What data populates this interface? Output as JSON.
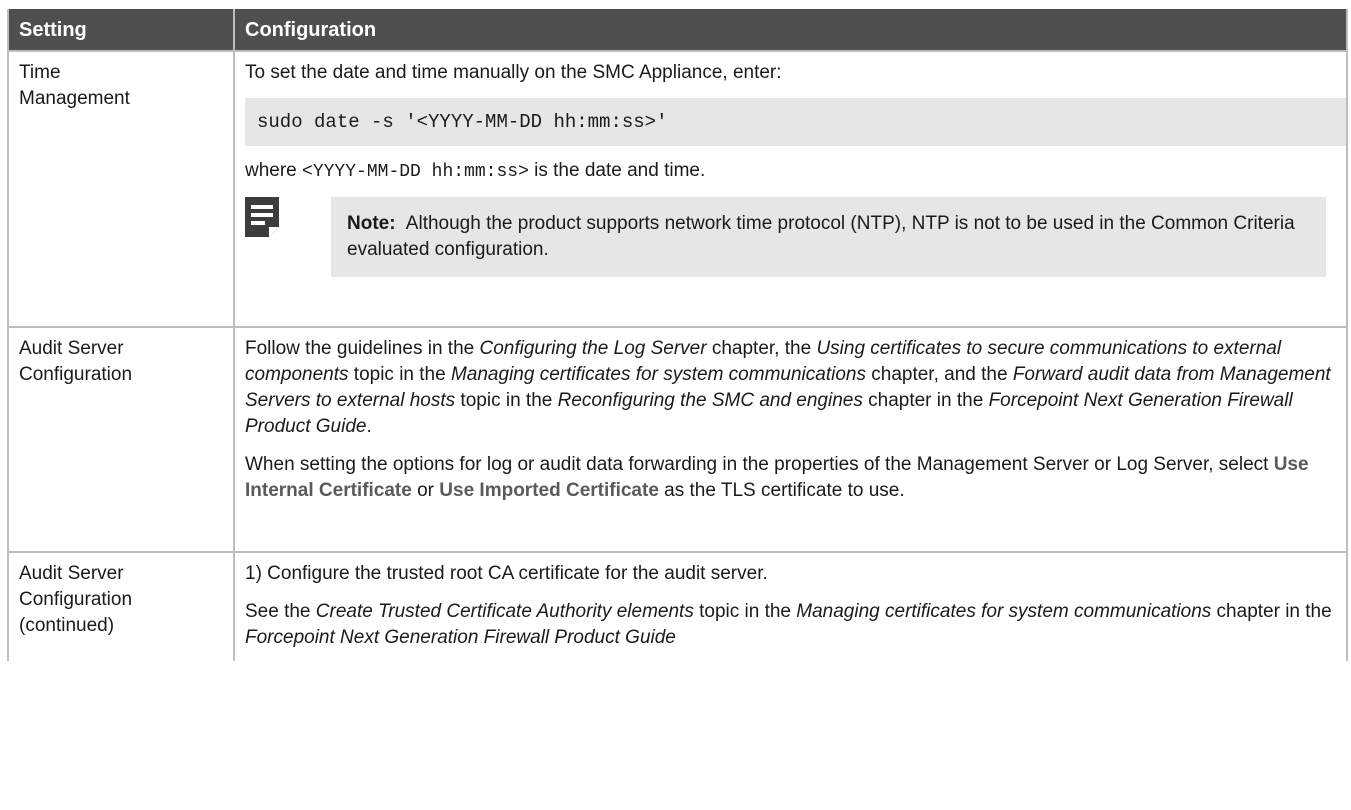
{
  "header": {
    "col_setting": "Setting",
    "col_configuration": "Configuration"
  },
  "row1": {
    "setting_line1": "Time",
    "setting_line2": "Management",
    "intro": "To set the date and time manually on the SMC Appliance, enter:",
    "command": "sudo date -s '<YYYY-MM-DD hh:mm:ss>'",
    "where_pre": "where ",
    "where_code": "<YYYY-MM-DD hh:mm:ss>",
    "where_post": " is the date and time.",
    "note_label": "Note:",
    "note_text": "Although the product supports network time protocol (NTP), NTP is not to be used in the Common Criteria evaluated configuration.",
    "note_icon": "note-icon"
  },
  "row2": {
    "setting_line1": "Audit Server",
    "setting_line2": "Configuration",
    "p1": {
      "t1": "Follow the guidelines in the ",
      "i1": "Configuring the Log Server",
      "t2": " chapter, the ",
      "i2": "Using certificates to secure communications to external components",
      "t3": " topic in the ",
      "i3": "Managing certificates for system communications",
      "t4": " chapter, and the ",
      "i4": "Forward audit data from Management Servers to external hosts",
      "t5": " topic in the ",
      "i5": "Reconfiguring the SMC and engines",
      "t6": " chapter in the ",
      "i6": "Forcepoint Next Generation Firewall Product Guide",
      "t7": "."
    },
    "p2": {
      "t1": "When setting the options for log or audit data forwarding in the properties of the Management Server or Log Server, select ",
      "b1": "Use Internal Certificate",
      "t2": " or ",
      "b2": "Use Imported Certificate",
      "t3": " as the TLS certificate to use."
    }
  },
  "row3": {
    "setting_line1": "Audit Server",
    "setting_line2": "Configuration",
    "setting_line3": "(continued)",
    "p1": "1) Configure the trusted root CA certificate for the audit server.",
    "p2": {
      "t1": "See the ",
      "i1": "Create Trusted Certificate Authority elements",
      "t2": " topic in the ",
      "i2": "Managing certificates for system communications",
      "t3": " chapter in the ",
      "i3": "Forcepoint Next Generation Firewall Product Guide"
    }
  }
}
